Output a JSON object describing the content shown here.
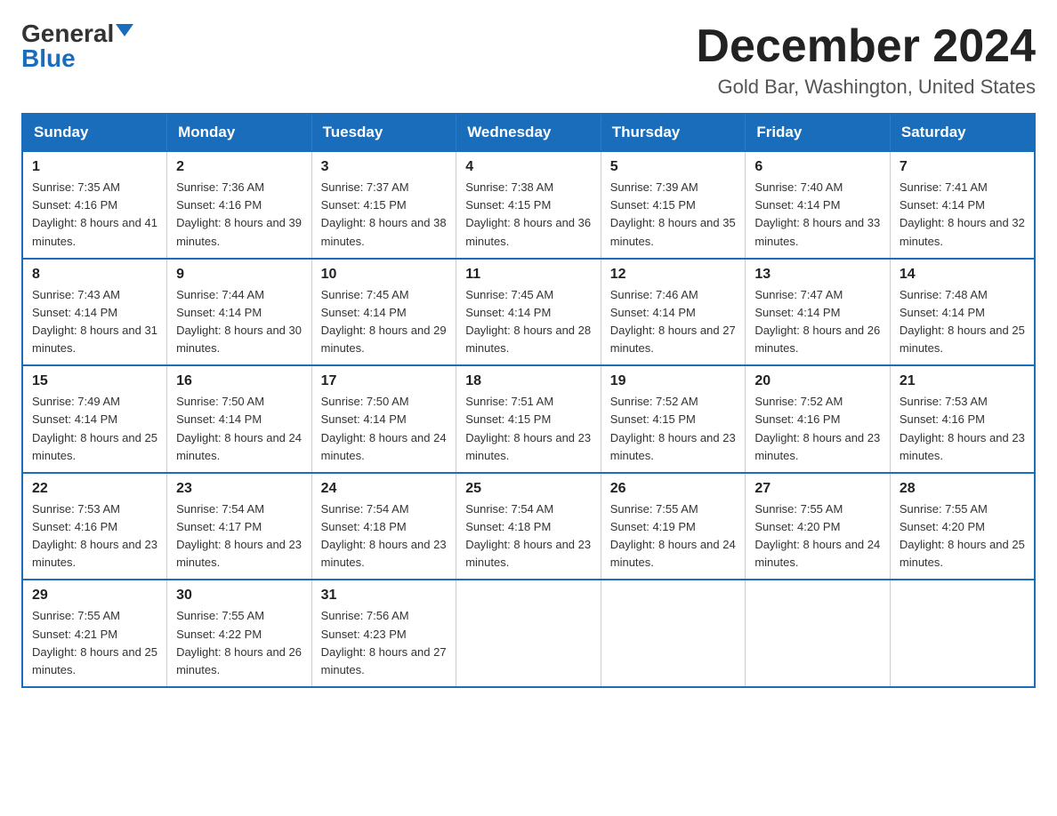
{
  "logo": {
    "general": "General",
    "blue": "Blue"
  },
  "title": {
    "month": "December 2024",
    "location": "Gold Bar, Washington, United States"
  },
  "days_of_week": [
    "Sunday",
    "Monday",
    "Tuesday",
    "Wednesday",
    "Thursday",
    "Friday",
    "Saturday"
  ],
  "weeks": [
    [
      {
        "day": "1",
        "sunrise": "7:35 AM",
        "sunset": "4:16 PM",
        "daylight": "8 hours and 41 minutes."
      },
      {
        "day": "2",
        "sunrise": "7:36 AM",
        "sunset": "4:16 PM",
        "daylight": "8 hours and 39 minutes."
      },
      {
        "day": "3",
        "sunrise": "7:37 AM",
        "sunset": "4:15 PM",
        "daylight": "8 hours and 38 minutes."
      },
      {
        "day": "4",
        "sunrise": "7:38 AM",
        "sunset": "4:15 PM",
        "daylight": "8 hours and 36 minutes."
      },
      {
        "day": "5",
        "sunrise": "7:39 AM",
        "sunset": "4:15 PM",
        "daylight": "8 hours and 35 minutes."
      },
      {
        "day": "6",
        "sunrise": "7:40 AM",
        "sunset": "4:14 PM",
        "daylight": "8 hours and 33 minutes."
      },
      {
        "day": "7",
        "sunrise": "7:41 AM",
        "sunset": "4:14 PM",
        "daylight": "8 hours and 32 minutes."
      }
    ],
    [
      {
        "day": "8",
        "sunrise": "7:43 AM",
        "sunset": "4:14 PM",
        "daylight": "8 hours and 31 minutes."
      },
      {
        "day": "9",
        "sunrise": "7:44 AM",
        "sunset": "4:14 PM",
        "daylight": "8 hours and 30 minutes."
      },
      {
        "day": "10",
        "sunrise": "7:45 AM",
        "sunset": "4:14 PM",
        "daylight": "8 hours and 29 minutes."
      },
      {
        "day": "11",
        "sunrise": "7:45 AM",
        "sunset": "4:14 PM",
        "daylight": "8 hours and 28 minutes."
      },
      {
        "day": "12",
        "sunrise": "7:46 AM",
        "sunset": "4:14 PM",
        "daylight": "8 hours and 27 minutes."
      },
      {
        "day": "13",
        "sunrise": "7:47 AM",
        "sunset": "4:14 PM",
        "daylight": "8 hours and 26 minutes."
      },
      {
        "day": "14",
        "sunrise": "7:48 AM",
        "sunset": "4:14 PM",
        "daylight": "8 hours and 25 minutes."
      }
    ],
    [
      {
        "day": "15",
        "sunrise": "7:49 AM",
        "sunset": "4:14 PM",
        "daylight": "8 hours and 25 minutes."
      },
      {
        "day": "16",
        "sunrise": "7:50 AM",
        "sunset": "4:14 PM",
        "daylight": "8 hours and 24 minutes."
      },
      {
        "day": "17",
        "sunrise": "7:50 AM",
        "sunset": "4:14 PM",
        "daylight": "8 hours and 24 minutes."
      },
      {
        "day": "18",
        "sunrise": "7:51 AM",
        "sunset": "4:15 PM",
        "daylight": "8 hours and 23 minutes."
      },
      {
        "day": "19",
        "sunrise": "7:52 AM",
        "sunset": "4:15 PM",
        "daylight": "8 hours and 23 minutes."
      },
      {
        "day": "20",
        "sunrise": "7:52 AM",
        "sunset": "4:16 PM",
        "daylight": "8 hours and 23 minutes."
      },
      {
        "day": "21",
        "sunrise": "7:53 AM",
        "sunset": "4:16 PM",
        "daylight": "8 hours and 23 minutes."
      }
    ],
    [
      {
        "day": "22",
        "sunrise": "7:53 AM",
        "sunset": "4:16 PM",
        "daylight": "8 hours and 23 minutes."
      },
      {
        "day": "23",
        "sunrise": "7:54 AM",
        "sunset": "4:17 PM",
        "daylight": "8 hours and 23 minutes."
      },
      {
        "day": "24",
        "sunrise": "7:54 AM",
        "sunset": "4:18 PM",
        "daylight": "8 hours and 23 minutes."
      },
      {
        "day": "25",
        "sunrise": "7:54 AM",
        "sunset": "4:18 PM",
        "daylight": "8 hours and 23 minutes."
      },
      {
        "day": "26",
        "sunrise": "7:55 AM",
        "sunset": "4:19 PM",
        "daylight": "8 hours and 24 minutes."
      },
      {
        "day": "27",
        "sunrise": "7:55 AM",
        "sunset": "4:20 PM",
        "daylight": "8 hours and 24 minutes."
      },
      {
        "day": "28",
        "sunrise": "7:55 AM",
        "sunset": "4:20 PM",
        "daylight": "8 hours and 25 minutes."
      }
    ],
    [
      {
        "day": "29",
        "sunrise": "7:55 AM",
        "sunset": "4:21 PM",
        "daylight": "8 hours and 25 minutes."
      },
      {
        "day": "30",
        "sunrise": "7:55 AM",
        "sunset": "4:22 PM",
        "daylight": "8 hours and 26 minutes."
      },
      {
        "day": "31",
        "sunrise": "7:56 AM",
        "sunset": "4:23 PM",
        "daylight": "8 hours and 27 minutes."
      },
      null,
      null,
      null,
      null
    ]
  ],
  "labels": {
    "sunrise": "Sunrise:",
    "sunset": "Sunset:",
    "daylight": "Daylight:"
  }
}
